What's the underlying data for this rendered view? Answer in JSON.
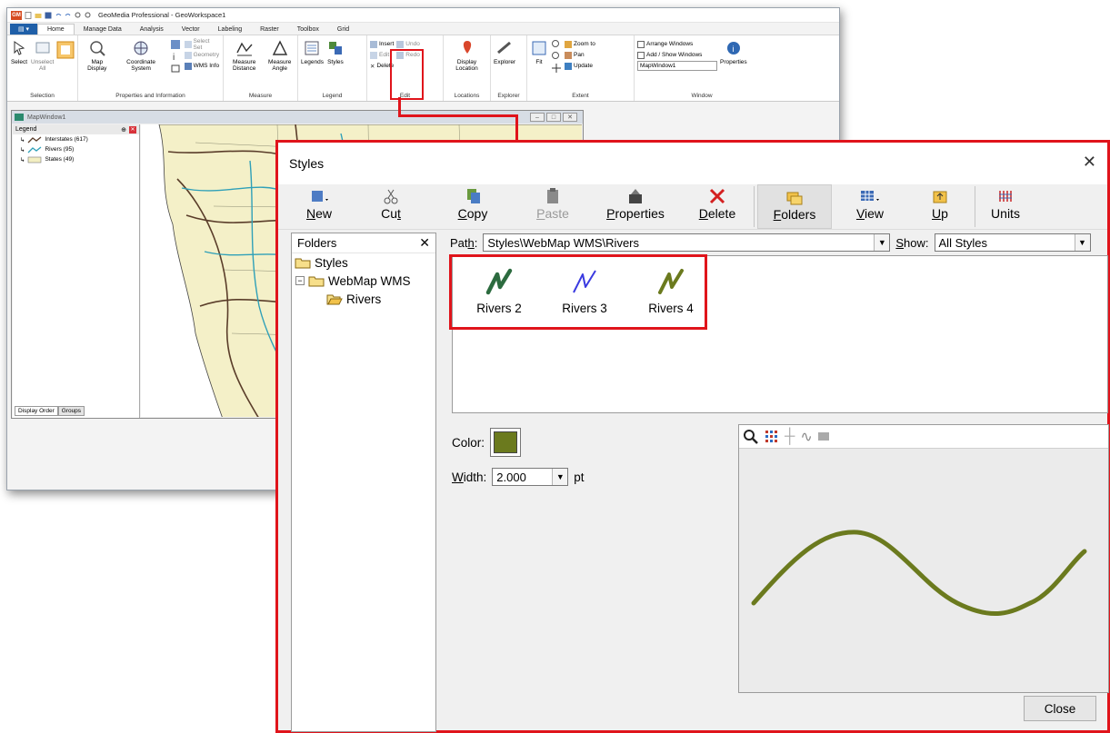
{
  "app": {
    "title": "GeoMedia Professional - GeoWorkspace1",
    "file_tab": "GM",
    "ribbon_tabs": [
      "Home",
      "Manage Data",
      "Analysis",
      "Vector",
      "Labeling",
      "Raster",
      "Toolbox",
      "Grid"
    ],
    "groups": {
      "selection": {
        "label": "Selection",
        "select": "Select",
        "unselect_all": "Unselect All"
      },
      "props_info": {
        "label": "Properties and Information",
        "map_display": "Map Display",
        "coordinate_system": "Coordinate System",
        "select_set": "Select Set",
        "geometry": "Geometry",
        "wms_info": "WMS Info"
      },
      "measure": {
        "label": "Measure",
        "distance": "Measure Distance",
        "angle": "Measure Angle"
      },
      "legend": {
        "label": "Legend",
        "legends": "Legends",
        "styles": "Styles"
      },
      "edit": {
        "label": "Edit",
        "insert": "Insert",
        "edit": "Edit",
        "delete": "Delete",
        "undo": "Undo",
        "redo": "Redo"
      },
      "locations": {
        "label": "Locations",
        "display_location": "Display Location"
      },
      "explorer": {
        "label": "Explorer",
        "explorer": "Explorer"
      },
      "extent": {
        "label": "Extent",
        "fit": "Fit",
        "zoom_to": "Zoom to",
        "pan": "Pan",
        "update": "Update"
      },
      "window": {
        "label": "Window",
        "arrange": "Arrange Windows",
        "add_show": "Add / Show Windows",
        "map_window": "MapWindow1",
        "properties": "Properties"
      }
    },
    "map_window": {
      "title": "MapWindow1",
      "legend_title": "Legend",
      "entries": [
        "Interstates (617)",
        "Rivers (95)",
        "States (49)"
      ],
      "tabs": [
        "Display Order",
        "Groups"
      ]
    }
  },
  "dialog": {
    "title": "Styles",
    "toolbar": [
      {
        "key": "N",
        "rest": "ew",
        "prefix": "",
        "label": "New"
      },
      {
        "key": "t",
        "rest": "",
        "prefix": "Cu",
        "label": "Cut"
      },
      {
        "key": "C",
        "rest": "opy",
        "prefix": "",
        "label": "Copy"
      },
      {
        "key": "P",
        "rest": "aste",
        "prefix": "",
        "label": "Paste"
      },
      {
        "key": "P",
        "rest": "roperties",
        "prefix": "",
        "label": "Properties"
      },
      {
        "key": "D",
        "rest": "elete",
        "prefix": "",
        "label": "Delete"
      },
      {
        "key": "F",
        "rest": "olders",
        "prefix": "",
        "label": "Folders"
      },
      {
        "key": "V",
        "rest": "iew",
        "prefix": "",
        "label": "View"
      },
      {
        "key": "U",
        "rest": "p",
        "prefix": "",
        "label": "Up"
      },
      {
        "key": "",
        "rest": "Units",
        "prefix": "",
        "label": "Units"
      }
    ],
    "folders": {
      "header": "Folders",
      "tree": [
        "Styles",
        "WebMap WMS",
        "Rivers"
      ]
    },
    "path_label_key": "h",
    "path_label_pre": "Pat",
    "path_label_post": ":",
    "path_value": "Styles\\WebMap WMS\\Rivers",
    "show_label_key": "S",
    "show_label_rest": "how:",
    "show_value": "All Styles",
    "styles": [
      {
        "name": "Rivers 2",
        "color": "#2c6b3f"
      },
      {
        "name": "Rivers 3",
        "color": "#3a3ae0"
      },
      {
        "name": "Rivers 4",
        "color": "#6b7a1e"
      }
    ],
    "color_label": "Color:",
    "selected_color": "#6b7a1e",
    "width_label_key": "W",
    "width_label_rest": "idth:",
    "width_value": "2.000",
    "width_unit": "pt",
    "close_label": "Close"
  }
}
